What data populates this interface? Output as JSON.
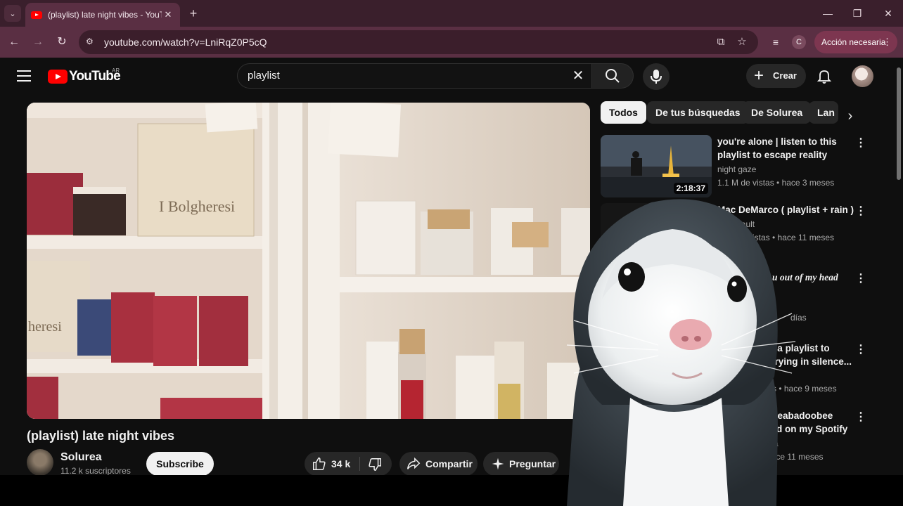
{
  "browser": {
    "tab_title": "(playlist) late night vibes - YouTube",
    "url": "youtube.com/watch?v=LniRqZ0P5cQ",
    "profile_initial": "C",
    "action_label": "Acción necesaria"
  },
  "youtube": {
    "logo_text": "YouTube",
    "country_code": "AR",
    "search_value": "playlist",
    "create_label": "Crear",
    "video": {
      "title": "(playlist) late night vibes",
      "channel": "Solurea",
      "subscribers": "11.2 k suscriptores",
      "subscribe_label": "Subscribe",
      "likes": "34 k",
      "share_label": "Compartir",
      "ask_label": "Preguntar",
      "scene_text": {
        "box_brand": "I Bolgheresi",
        "box_brand_partial": "heresi"
      }
    },
    "chips": [
      "Todos",
      "De tus búsquedas",
      "De Solurea",
      "Lan"
    ],
    "recommendations": [
      {
        "title": "you're alone | listen to this playlist to escape reality",
        "channel": "night gaze",
        "meta": "1.1 M de vistas • hace 3 meses",
        "duration": "2:18:37"
      },
      {
        "title": "Mac DeMarco ( playlist + rain )",
        "channel": "eVault",
        "meta": "istas • hace 11 meses"
      },
      {
        "title": "u out of my head",
        "channel": "",
        "meta": "días"
      },
      {
        "title": "|| a playlist to crying in silence...",
        "channel": "",
        "meta": "stas • hace 9 meses"
      },
      {
        "title": "and Beabadoobee /Based on my Spotify ...",
        "channel": "mma",
        "meta": "hace 11 meses"
      }
    ]
  }
}
